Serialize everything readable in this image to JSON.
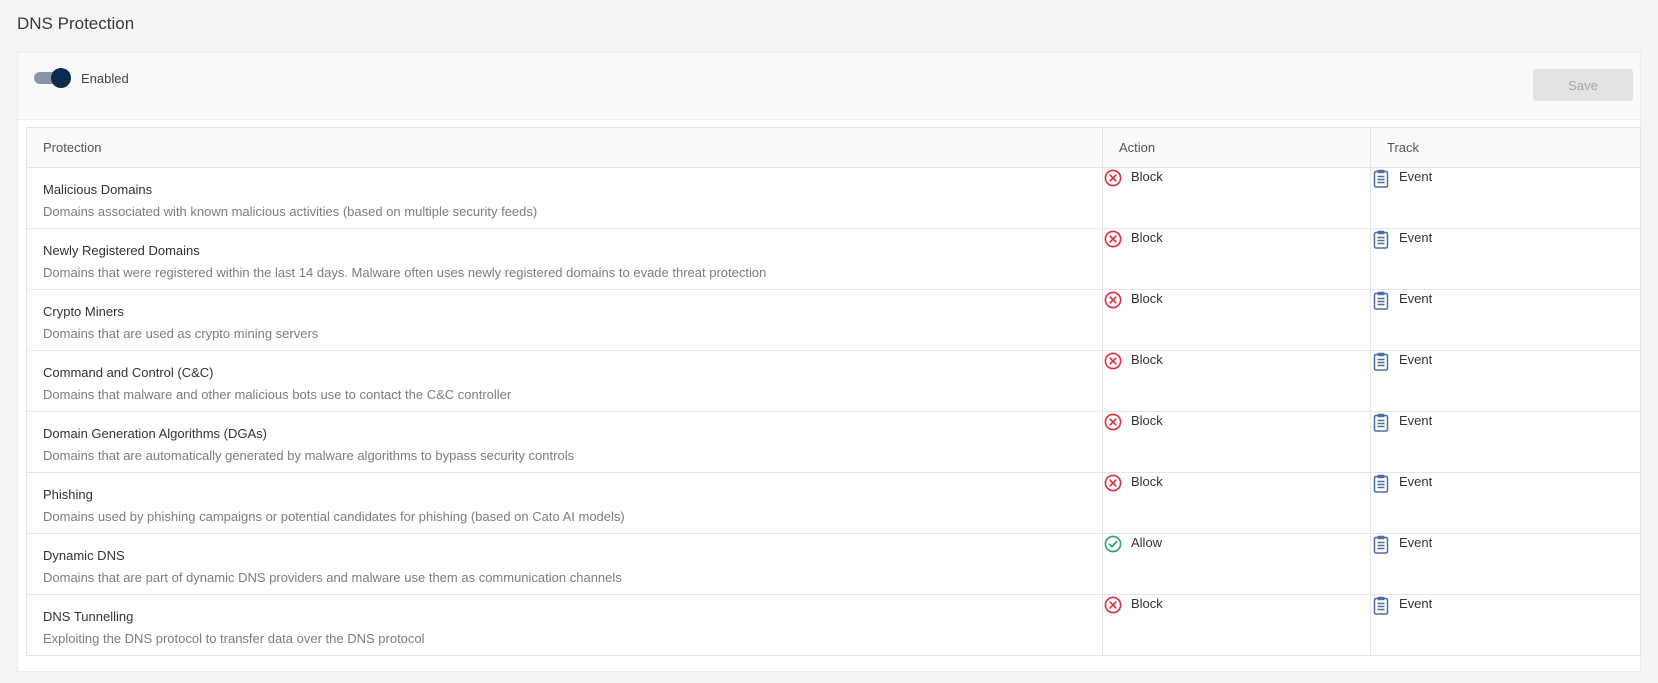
{
  "page": {
    "title": "DNS Protection"
  },
  "toolbar": {
    "toggle_label": "Enabled",
    "toggle_on": true,
    "save_label": "Save"
  },
  "table": {
    "headers": {
      "protection": "Protection",
      "action": "Action",
      "track": "Track"
    },
    "rows": [
      {
        "name": "Malicious Domains",
        "description": "Domains associated with known malicious activities (based on multiple security feeds)",
        "action": "Block",
        "action_icon": "block-icon",
        "track": "Event",
        "track_icon": "clipboard-icon"
      },
      {
        "name": "Newly Registered Domains",
        "description": "Domains that were registered within the last 14 days. Malware often uses newly registered domains to evade threat protection",
        "action": "Block",
        "action_icon": "block-icon",
        "track": "Event",
        "track_icon": "clipboard-icon"
      },
      {
        "name": "Crypto Miners",
        "description": "Domains that are used as crypto mining servers",
        "action": "Block",
        "action_icon": "block-icon",
        "track": "Event",
        "track_icon": "clipboard-icon"
      },
      {
        "name": "Command and Control (C&C)",
        "description": "Domains that malware and other malicious bots use to contact the C&C controller",
        "action": "Block",
        "action_icon": "block-icon",
        "track": "Event",
        "track_icon": "clipboard-icon"
      },
      {
        "name": "Domain Generation Algorithms (DGAs)",
        "description": "Domains that are automatically generated by malware algorithms to bypass security controls",
        "action": "Block",
        "action_icon": "block-icon",
        "track": "Event",
        "track_icon": "clipboard-icon"
      },
      {
        "name": "Phishing",
        "description": "Domains used by phishing campaigns or potential candidates for phishing (based on Cato AI models)",
        "action": "Block",
        "action_icon": "block-icon",
        "track": "Event",
        "track_icon": "clipboard-icon"
      },
      {
        "name": "Dynamic DNS",
        "description": "Domains that are part of dynamic DNS providers and malware use them as communication channels",
        "action": "Allow",
        "action_icon": "allow-icon",
        "track": "Event",
        "track_icon": "clipboard-icon"
      },
      {
        "name": "DNS Tunnelling",
        "description": "Exploiting the DNS protocol to transfer data over the DNS protocol",
        "action": "Block",
        "action_icon": "block-icon",
        "track": "Event",
        "track_icon": "clipboard-icon"
      }
    ]
  },
  "colors": {
    "block": "#e0303c",
    "allow": "#2aa37a",
    "track_icon": "#4a6fa5",
    "toggle_knob": "#0d2a4f",
    "toggle_track": "#8a94a6"
  }
}
